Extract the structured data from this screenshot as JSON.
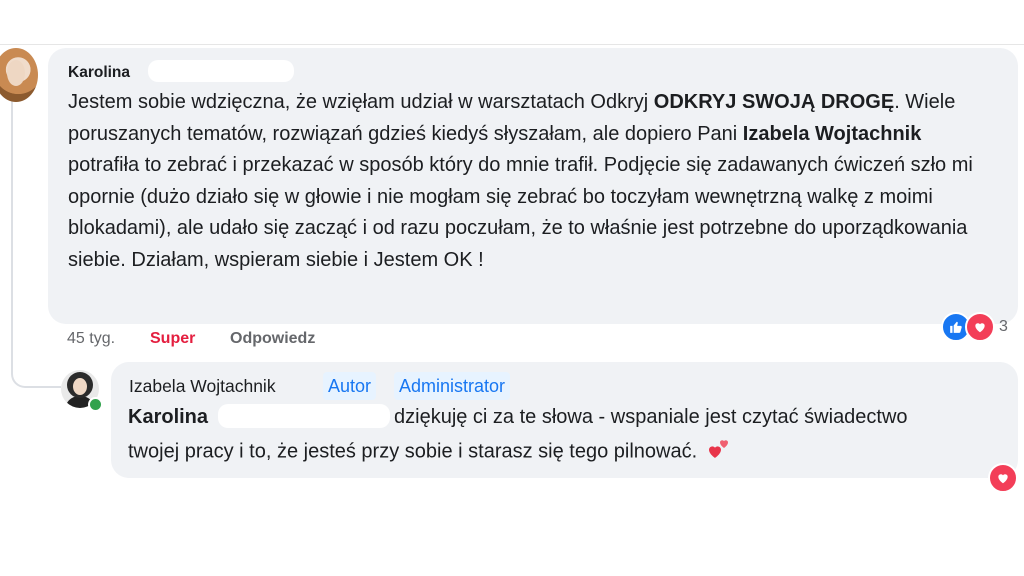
{
  "comment": {
    "author_visible": "Karolina",
    "body_parts": {
      "p1": "Jestem sobie wdzięczna, że wzięłam udział w warsztatach Odkryj ",
      "p1_bold": "ODKRYJ SWOJĄ DROGĘ",
      "p2": ". Wiele poruszanych tematów, rozwiązań gdzieś kiedyś słyszałam, ale dopiero Pani ",
      "p2_bold": "Izabela Wojtachnik",
      "p3": " potrafiła to zebrać i przekazać w sposób który do mnie trafił. Podjęcie się zadawanych ćwiczeń szło mi opornie (dużo działo się w głowie i nie mogłam się zebrać bo toczyłam wewnętrzną walkę z moimi blokadami), ale udało się zacząć i od razu poczułam, że to właśnie jest potrzebne do uporządkowania siebie. Działam, wspieram siebie i Jestem OK !"
    },
    "time": "45 tyg.",
    "reaction_label": "Super",
    "reply_label": "Odpowiedz",
    "reaction_count": "3",
    "like_color": "#1877f2",
    "love_color": "#f33e58"
  },
  "reply": {
    "author": "Izabela Wojtachnik",
    "badge_author": "Autor",
    "badge_admin": "Administrator",
    "mention": "Karolina",
    "text_line1": "dziękuję ci za te słowa - wspaniale jest czytać świadectwo",
    "text_line2": "twojej pracy i to, że jesteś przy sobie i starasz się tego pilnować.",
    "emoji": "two-hearts-icon"
  },
  "colors": {
    "bubble": "#f0f2f5",
    "accent": "#1877f2",
    "super_red": "#e41e3f",
    "meta_gray": "#65676b",
    "online_green": "#31a24c"
  }
}
